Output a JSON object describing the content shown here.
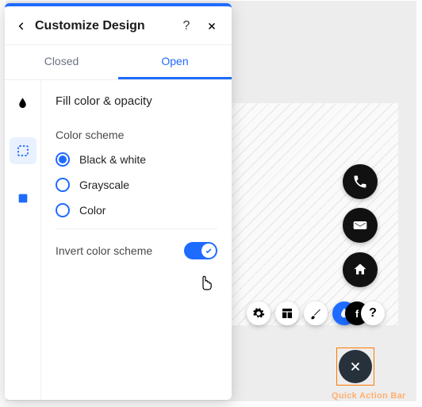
{
  "panel": {
    "title": "Customize Design",
    "tabs": {
      "closed": "Closed",
      "open": "Open"
    },
    "section_title": "Fill color & opacity",
    "color_scheme_label": "Color scheme",
    "options": {
      "bw": "Black & white",
      "gray": "Grayscale",
      "color": "Color"
    },
    "selected_option": "bw",
    "invert_label": "Invert color scheme",
    "invert_on": true
  },
  "canvas": {
    "quick_action_label": "Quick Action Bar"
  },
  "icons": {
    "back": "chevron-left",
    "help": "question",
    "close": "x",
    "drop": "water-drop",
    "fill_section": "water-drop",
    "select_tool": "selection-dashed",
    "shape_tool": "filled-square",
    "phone": "phone",
    "mail": "mail",
    "home": "home",
    "gear": "gear",
    "layout": "layout",
    "brush": "brush",
    "drop_blue": "water-drop",
    "overlay_fb": "facebook",
    "help_small": "question",
    "close_circle": "x"
  },
  "colors": {
    "accent": "#1f6bff",
    "orange": "#ff7a00"
  }
}
